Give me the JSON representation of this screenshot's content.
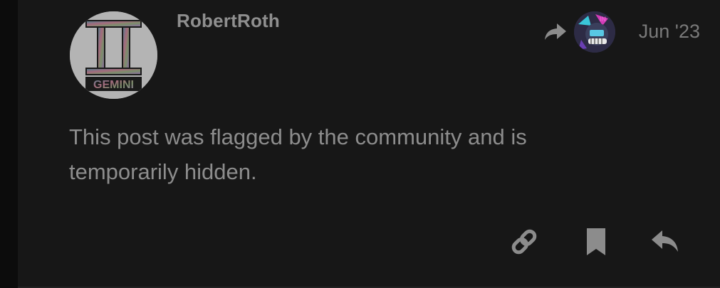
{
  "post": {
    "username": "RobertRoth",
    "date": "Jun '23",
    "body": "This post was flagged by the community and is temporarily hidden.",
    "avatar": {
      "text": "GEMINI",
      "description": "gemini-zodiac-logo",
      "background": "#b4b4b4"
    },
    "reply_to_avatar": {
      "description": "neon-character-avatar"
    }
  },
  "actions": {
    "link_icon": "link-icon",
    "bookmark_icon": "bookmark-icon",
    "reply_icon": "reply-icon"
  },
  "colors": {
    "background": "#171717",
    "text": "#8d8d8d",
    "muted": "#7a7a7a",
    "icon": "#8c8c8c"
  }
}
